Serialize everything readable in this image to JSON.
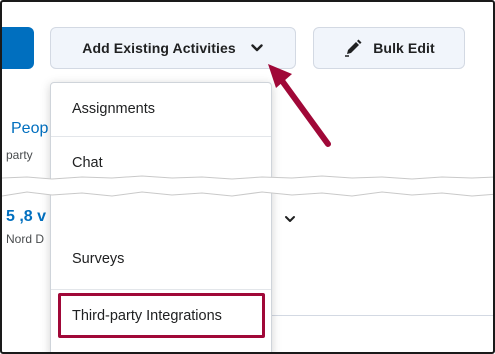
{
  "toolbar": {
    "add_existing_label": "Add Existing Activities",
    "bulk_edit_label": "Bulk Edit"
  },
  "background": {
    "link_text": "Peop",
    "sub_text": "party",
    "link2_text": "5 ,8 v",
    "sub2_text": "Nord D"
  },
  "dropdown": {
    "items": [
      {
        "label": "Assignments"
      },
      {
        "label": "Chat"
      },
      {
        "label": "Surveys"
      },
      {
        "label": "Third-party Integrations"
      }
    ]
  },
  "colors": {
    "accent": "#006fbf",
    "highlight": "#a00838"
  }
}
